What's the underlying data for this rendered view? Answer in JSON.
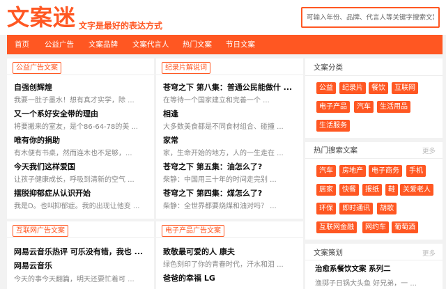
{
  "header": {
    "logo": "文案迷",
    "slogan": "文字是最好的表达方式",
    "search_placeholder": "可输入年份、品牌、代言人等关键字搜索文案"
  },
  "nav": [
    "首页",
    "公益广告",
    "文案品牌",
    "文案代言人",
    "热门文案",
    "节日文案"
  ],
  "sections": {
    "gongyi": {
      "tag": "公益广告文案",
      "items": [
        {
          "title": "自强创辉煌",
          "desc": "我要一肚子墨水！想有真才实学，除 ..."
        },
        {
          "title": "又一个系好安全带的理由",
          "desc": "将要搬来的室友，是个86-64-78的美 ..."
        },
        {
          "title": "唯有你的捐助",
          "desc": "有木便有书桌，然而连木也不足够，..."
        },
        {
          "title": "今天我们这样爱国",
          "desc": "让孩子健康成长，呼吸到清新的空气 ..."
        },
        {
          "title": "摆脱抑郁症从认识开始",
          "desc": "我是D。也叫抑郁症。我的出现让他变 ..."
        }
      ]
    },
    "jilupian": {
      "tag": "纪录片解说词",
      "items": [
        {
          "title": "苍穹之下 第八集：普通公民能做什 ...",
          "desc": "在等待一个国家建立和完善一个 ..."
        },
        {
          "title": "相逢",
          "desc": "大多数美食都是不同食材组合、碰撞 ..."
        },
        {
          "title": "家常",
          "desc": "家，生命开始的地方，人的一生走在 ..."
        },
        {
          "title": "苍穹之下 第五集：油怎么了?",
          "desc": "柴静：中国用三十年的时间走完别 ..."
        },
        {
          "title": "苍穹之下 第四集：煤怎么了?",
          "desc": "柴静：全世界都要烧煤和油对吗？ ..."
        }
      ]
    },
    "hulianwang": {
      "tag": "互联网广告文案",
      "items": [
        {
          "title": "网易云音乐热评 可乐没有错，我也 ... 网易云音乐",
          "desc": "今天的事今天翻篇，明天还要忙着可 ..."
        }
      ]
    },
    "dianzi": {
      "tag": "电子产品广告文案",
      "items": [
        {
          "title": "致敬最可爱的人 康夫",
          "desc": "绿色刻印了你的青春时代，汗水和泪 ..."
        },
        {
          "title": "爸爸的幸福 LG",
          "desc": ""
        }
      ]
    }
  },
  "sidebar": {
    "categories": {
      "title": "文案分类",
      "tags": [
        "公益",
        "纪录片",
        "餐饮",
        "互联网",
        "电子产品",
        "汽车",
        "生活用品",
        "生活服务"
      ]
    },
    "hot": {
      "title": "热门搜索文案",
      "more": "更多",
      "tags": [
        "汽车",
        "房地产",
        "电子商务",
        "手机",
        "居家",
        "快餐",
        "报纸",
        "鞋",
        "关爱老人",
        "环保",
        "即时通讯",
        "胡歌",
        "互联网金融",
        "网约车",
        "葡萄酒"
      ]
    },
    "cehua": {
      "title": "文案策划",
      "more": "更多",
      "item_title": "治愈系餐饮文案 系列二",
      "item_desc": "渔掷子日锅大头鱼 好兄弟，一 ..."
    }
  },
  "colors": {
    "accent": "#ff5722",
    "background": "#f2f2f2"
  }
}
